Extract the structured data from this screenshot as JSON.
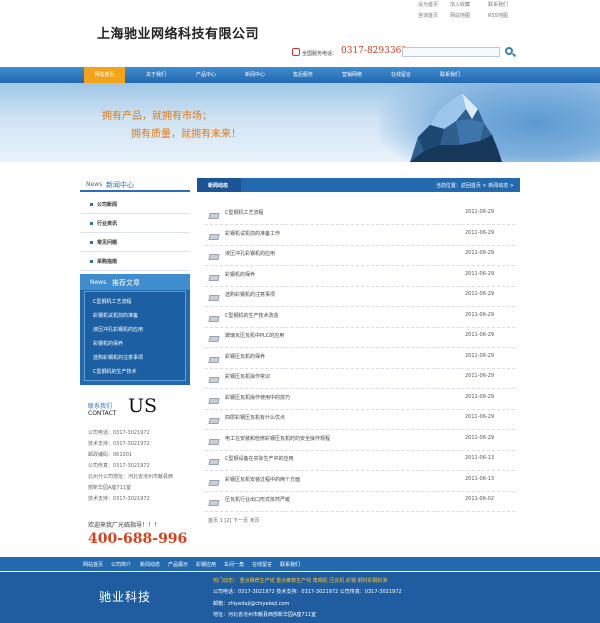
{
  "top_links": [
    "设为首页",
    "加入收藏",
    "联系我们",
    "咨询首页",
    "网站地图",
    "RSS地图"
  ],
  "company_name": "上海驰业网络科技有限公司",
  "hotline": {
    "label": "全国服务电话：",
    "number": "0317-8293369"
  },
  "search": {
    "placeholder": ""
  },
  "nav": [
    "网站首页",
    "关于我们",
    "产品中心",
    "新闻中心",
    "售后服务",
    "营销网络",
    "在线留言",
    "联系我们"
  ],
  "nav_active": 0,
  "banner": {
    "line1": "拥有产品，就拥有市场；",
    "line2": "拥有质量，就拥有未来！"
  },
  "sidebar": {
    "news_en": "News",
    "news_cn": "新闻中心",
    "categories": [
      "公司新闻",
      "行业资讯",
      "常见问题",
      "采购指南"
    ],
    "rec_en": "News",
    "rec_cn": "推荐文章",
    "rec_items": [
      "C型钢机工艺流程",
      "彩钢机试机前的准备",
      "液压冲孔彩钢机的应用",
      "彩钢机的保养",
      "选购彩钢机的注意事项",
      "C型钢机的生产技术"
    ]
  },
  "contact": {
    "cn": "联系我们",
    "en": "CONTACT",
    "us": "US",
    "lines": [
      "公司电话：0317-3021972",
      "技术支持：0317-3021972",
      "邮政编码：061001",
      "公司传真：0317-3021972",
      "北州分公司地址：河北省沧州市献县西",
      "部新华园A座711室",
      "技术支持：0317-3021972"
    ]
  },
  "welcome": "欢迎来我厂光临指导！！！",
  "big_tel": "400-688-996",
  "main": {
    "title": "新闻动态",
    "crumb": "当前位置：返回首页 > 新闻动态 >",
    "articles": [
      {
        "title": "C型钢机工艺流程",
        "date": "2011-06-29"
      },
      {
        "title": "彩钢机试机前的准备工作",
        "date": "2011-06-29"
      },
      {
        "title": "液压冲孔彩钢机的应用",
        "date": "2011-06-29"
      },
      {
        "title": "彩钢机的保养",
        "date": "2011-06-29"
      },
      {
        "title": "选购彩钢机的注意事项",
        "date": "2011-06-29"
      },
      {
        "title": "C型钢机的生产技术改造",
        "date": "2011-06-29"
      },
      {
        "title": "玻璃瓦压瓦机中PLC的应用",
        "date": "2011-06-29"
      },
      {
        "title": "彩钢压瓦机的保养",
        "date": "2011-06-29"
      },
      {
        "title": "彩钢压瓦机操作常识",
        "date": "2011-06-29"
      },
      {
        "title": "彩钢压瓦机操作使用中的技巧",
        "date": "2011-06-29"
      },
      {
        "title": "四层彩钢压瓦机有什么优点",
        "date": "2011-06-29"
      },
      {
        "title": "电工在安装和检修彩钢压瓦机时的安全操作规程",
        "date": "2011-06-29"
      },
      {
        "title": "C型钢设备在实际生产中的应用",
        "date": "2011-06-13"
      },
      {
        "title": "彩钢压瓦机安装过程中的两个方面",
        "date": "2011-06-13"
      },
      {
        "title": "压瓦机行业出口形式依然严峻",
        "date": "2011-06-02"
      }
    ],
    "pager": "首页 1 [2] 下一页 末页"
  },
  "footer_nav": [
    "网站首页",
    "公司简介",
    "新闻动态",
    "产品展示",
    "彩钢应用",
    "车间一角",
    "在线留言",
    "联系我们"
  ],
  "footer": {
    "brand": "驰业科技",
    "hot": "热门动态：  重点推荐生产线 重点推荐生产线 角钢机 压瓦机 彩钢 钢材彩钢标准",
    "tel": "公司电话：0317-3021972  技术支持：0317-3021972  公司传真：0317-3021972",
    "email": "邮箱：zhiyedaji@chiyekeji.com",
    "addr": "地址：河北省沧州市献县西部新华园A座711室"
  }
}
